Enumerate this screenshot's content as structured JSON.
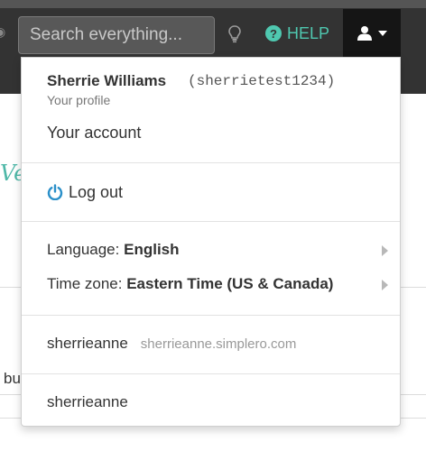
{
  "topbar": {
    "search_placeholder": "Search everything...",
    "help_label": "HELP"
  },
  "background": {
    "script_fragment": "Ve",
    "text_fragment": "bu"
  },
  "dropdown": {
    "profile_name": "Sherrie Williams",
    "profile_username": "(sherrietest1234)",
    "profile_sub": "Your profile",
    "account_link": "Your account",
    "logout_label": "Log out",
    "language_label": "Language:",
    "language_value": "English",
    "timezone_label": "Time zone:",
    "timezone_value": "Eastern Time (US & Canada)",
    "sites": [
      {
        "name": "sherrieanne",
        "domain": "sherrieanne.simplero.com"
      },
      {
        "name": "sherrieanne",
        "domain": ""
      }
    ]
  },
  "colors": {
    "topbar_bg": "#333333",
    "accent_teal": "#4fc8b0",
    "power_icon_blue": "#2a8fc9",
    "user_button_bg": "#151515"
  },
  "icons": [
    "eye-icon",
    "lightbulb-icon",
    "question-circle-icon",
    "user-icon",
    "chevron-down-icon",
    "power-icon",
    "chevron-right-icon"
  ]
}
